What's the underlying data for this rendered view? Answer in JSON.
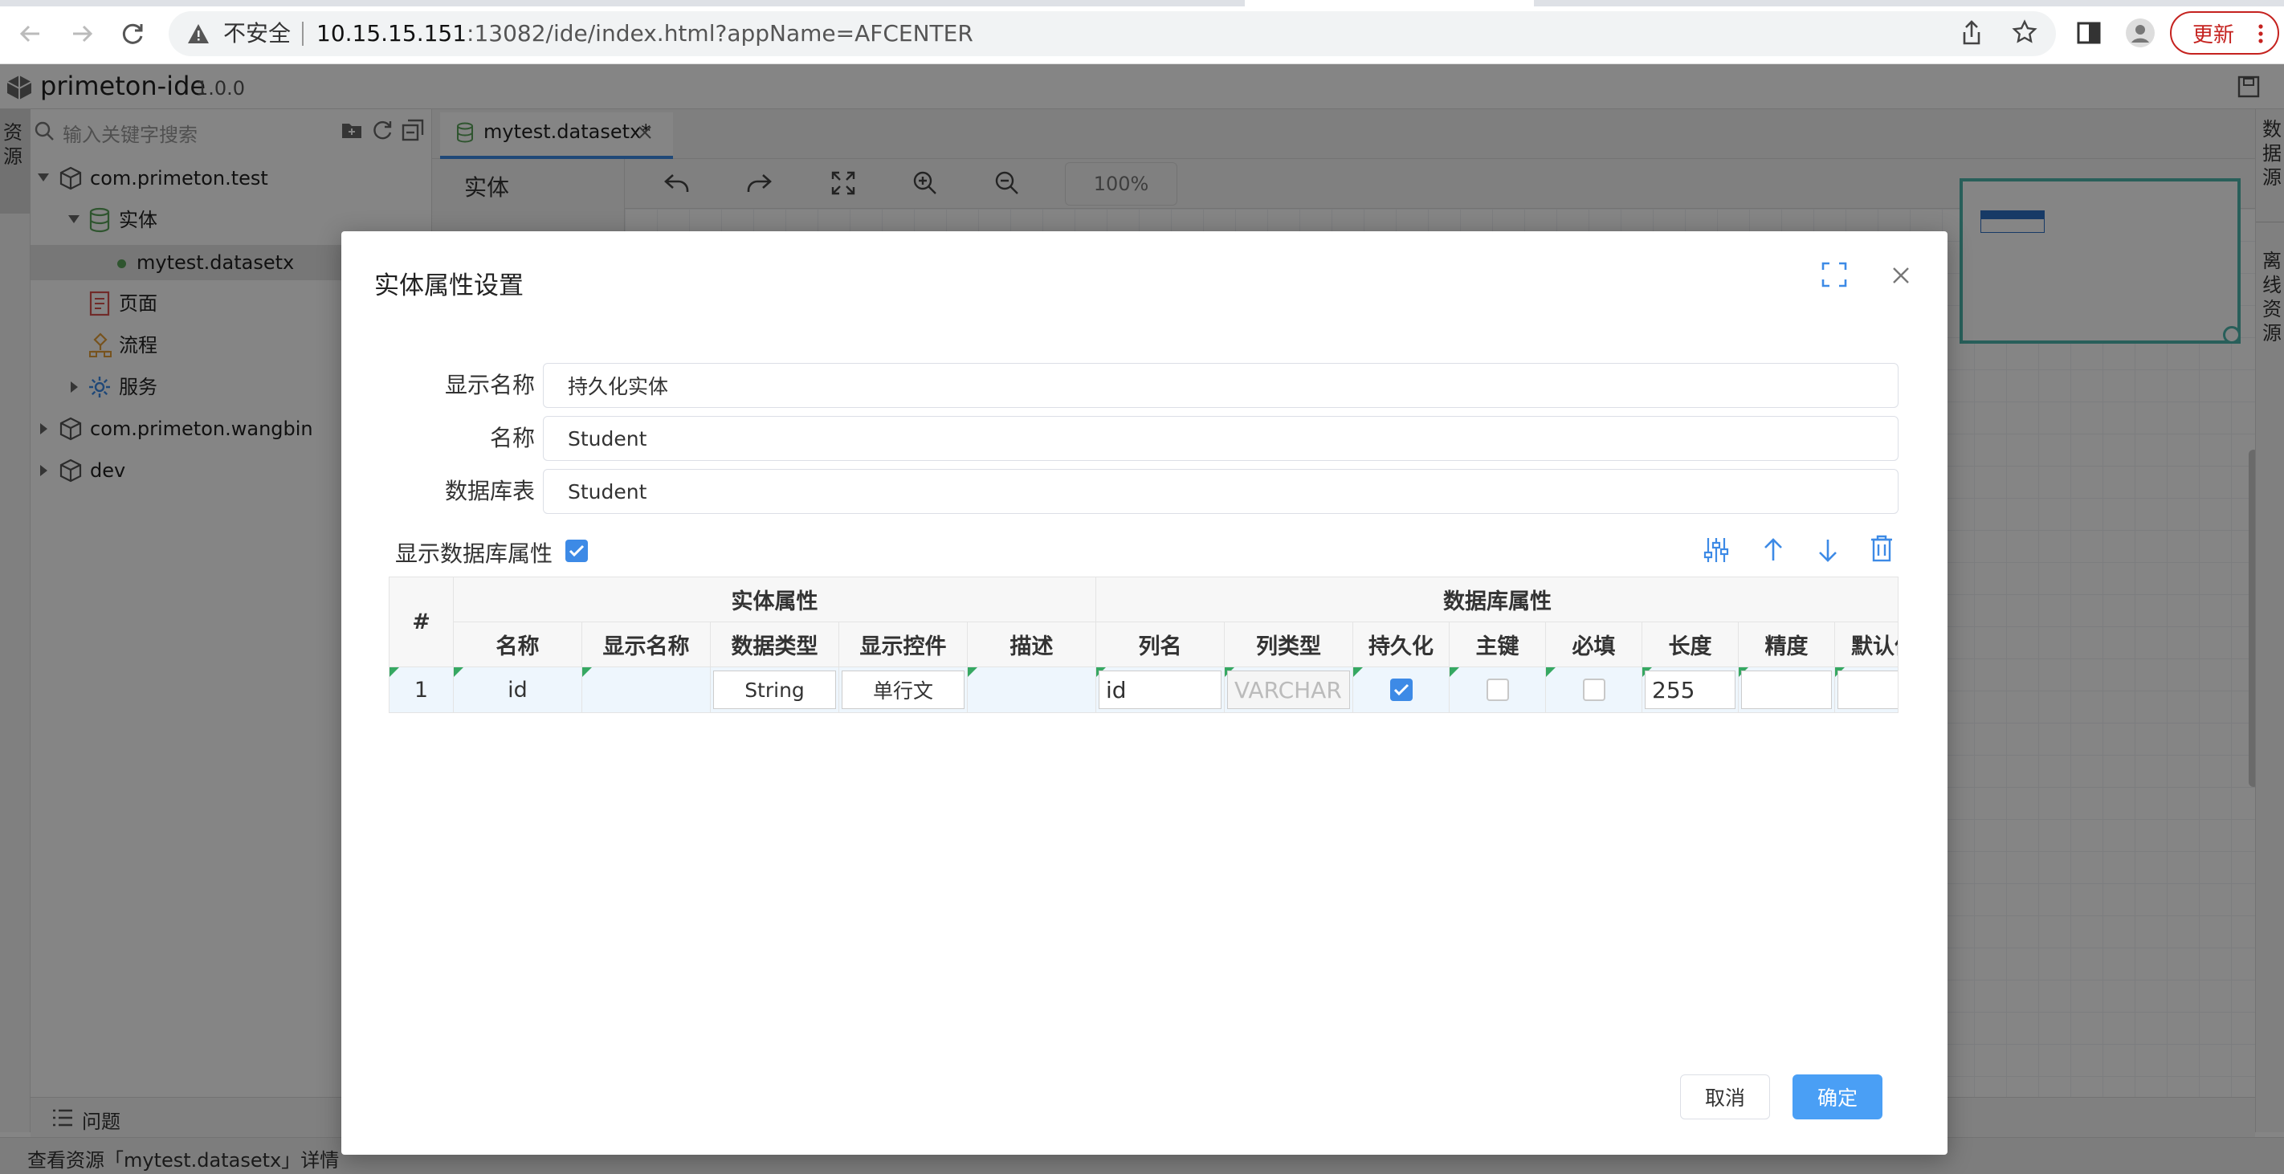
{
  "browser": {
    "insecure_label": "不安全",
    "url_host": "10.15.15.151",
    "url_rest": ":13082/ide/index.html?appName=AFCENTER",
    "update_label": "更新"
  },
  "ide": {
    "name": "primeton-ide",
    "version": "1.0.0",
    "left_tabs": [
      "资源"
    ],
    "right_tabs": [
      "数据源",
      "离线资源"
    ],
    "search_placeholder": "输入关键字搜索",
    "tree": [
      {
        "label": "com.primeton.test",
        "icon": "package-icon"
      },
      {
        "label": "实体",
        "icon": "database-icon"
      },
      {
        "label": "mytest.datasetx",
        "icon": "dot-icon"
      },
      {
        "label": "页面",
        "icon": "page-icon"
      },
      {
        "label": "流程",
        "icon": "flow-icon"
      },
      {
        "label": "服务",
        "icon": "gear-icon"
      },
      {
        "label": "com.primeton.wangbin",
        "icon": "package-icon"
      },
      {
        "label": "dev",
        "icon": "package-icon"
      }
    ],
    "editor_tab": "mytest.datasetx*",
    "palette_title": "实体",
    "zoom": "100%",
    "bottom_panel": "问题",
    "status": "查看资源「mytest.datasetx」详情"
  },
  "dialog": {
    "title": "实体属性设置",
    "fields": {
      "display_name_label": "显示名称",
      "display_name_value": "持久化实体",
      "name_label": "名称",
      "name_value": "Student",
      "table_label": "数据库表",
      "table_value": "Student"
    },
    "show_db_label": "显示数据库属性",
    "show_db_checked": true,
    "grid": {
      "index_header": "#",
      "group_entity": "实体属性",
      "group_db": "数据库属性",
      "columns": [
        "名称",
        "显示名称",
        "数据类型",
        "显示控件",
        "描述",
        "列名",
        "列类型",
        "持久化",
        "主键",
        "必填",
        "长度",
        "精度",
        "默认值"
      ],
      "rows": [
        {
          "index": "1",
          "name": "id",
          "display_name": "",
          "data_type": "String",
          "control": "单行文",
          "desc": "",
          "column_name": "id",
          "column_type": "VARCHAR",
          "persistent": true,
          "primary_key": false,
          "required": false,
          "length": "255",
          "precision": "",
          "default": ""
        }
      ]
    },
    "cancel_label": "取消",
    "ok_label": "确定"
  },
  "colors": {
    "accent": "#3d8ae6",
    "ok_button": "#4a9ff5",
    "update": "#c5221f",
    "minimap": "#4db6ac"
  }
}
